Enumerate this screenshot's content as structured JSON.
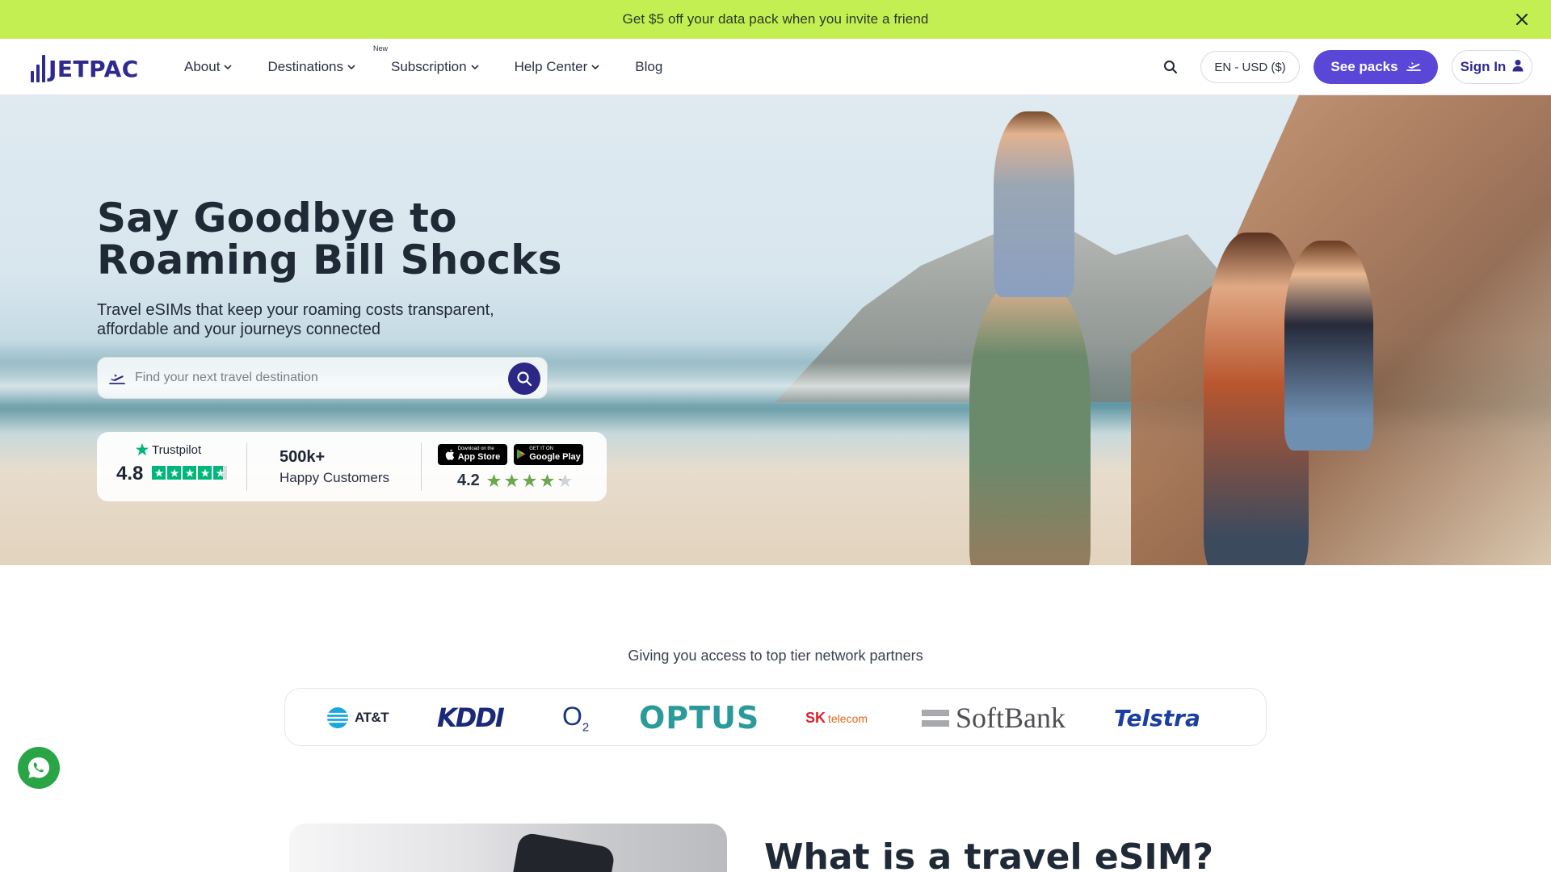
{
  "promo": {
    "text": "Get $5 off your data pack when you invite a friend",
    "close_icon": "close-icon"
  },
  "header": {
    "logo_text": "JETPAC",
    "nav": [
      {
        "label": "About",
        "has_dropdown": true
      },
      {
        "label": "Destinations",
        "has_dropdown": true
      },
      {
        "label": "Subscription",
        "has_dropdown": true,
        "badge": "New"
      },
      {
        "label": "Help Center",
        "has_dropdown": true
      },
      {
        "label": "Blog",
        "has_dropdown": false
      }
    ],
    "search_icon": "search-icon",
    "locale": "EN - USD ($)",
    "see_packs": "See packs",
    "sign_in": "Sign In"
  },
  "hero": {
    "title_line1": "Say Goodbye to",
    "title_line2": "Roaming Bill Shocks",
    "subtitle_line1": "Travel eSIMs that keep your roaming costs transparent,",
    "subtitle_line2": "affordable and your journeys connected",
    "search_placeholder": "Find your next travel destination",
    "trustpilot": {
      "brand": "Trustpilot",
      "score": "4.8",
      "stars": 4.7
    },
    "customers": {
      "count": "500k+",
      "label": "Happy Customers"
    },
    "apps": {
      "app_store_small": "Download on the",
      "app_store": "App Store",
      "google_play_small": "GET IT ON",
      "google_play": "Google Play",
      "score": "4.2",
      "stars": 4.2
    }
  },
  "partners": {
    "title": "Giving you access to top tier network partners",
    "logos": [
      "AT&T",
      "KDDI",
      "O",
      "2",
      "OPTUS",
      "SK",
      "telecom",
      "SoftBank",
      "Telstra"
    ]
  },
  "whats_esim": {
    "title": "What is a travel eSIM?"
  },
  "colors": {
    "promo_bg": "#c4ef52",
    "brand": "#2f2a8f",
    "accent": "#5a47d8",
    "trustpilot_green": "#00b67a",
    "whatsapp_green": "#2aa546"
  }
}
